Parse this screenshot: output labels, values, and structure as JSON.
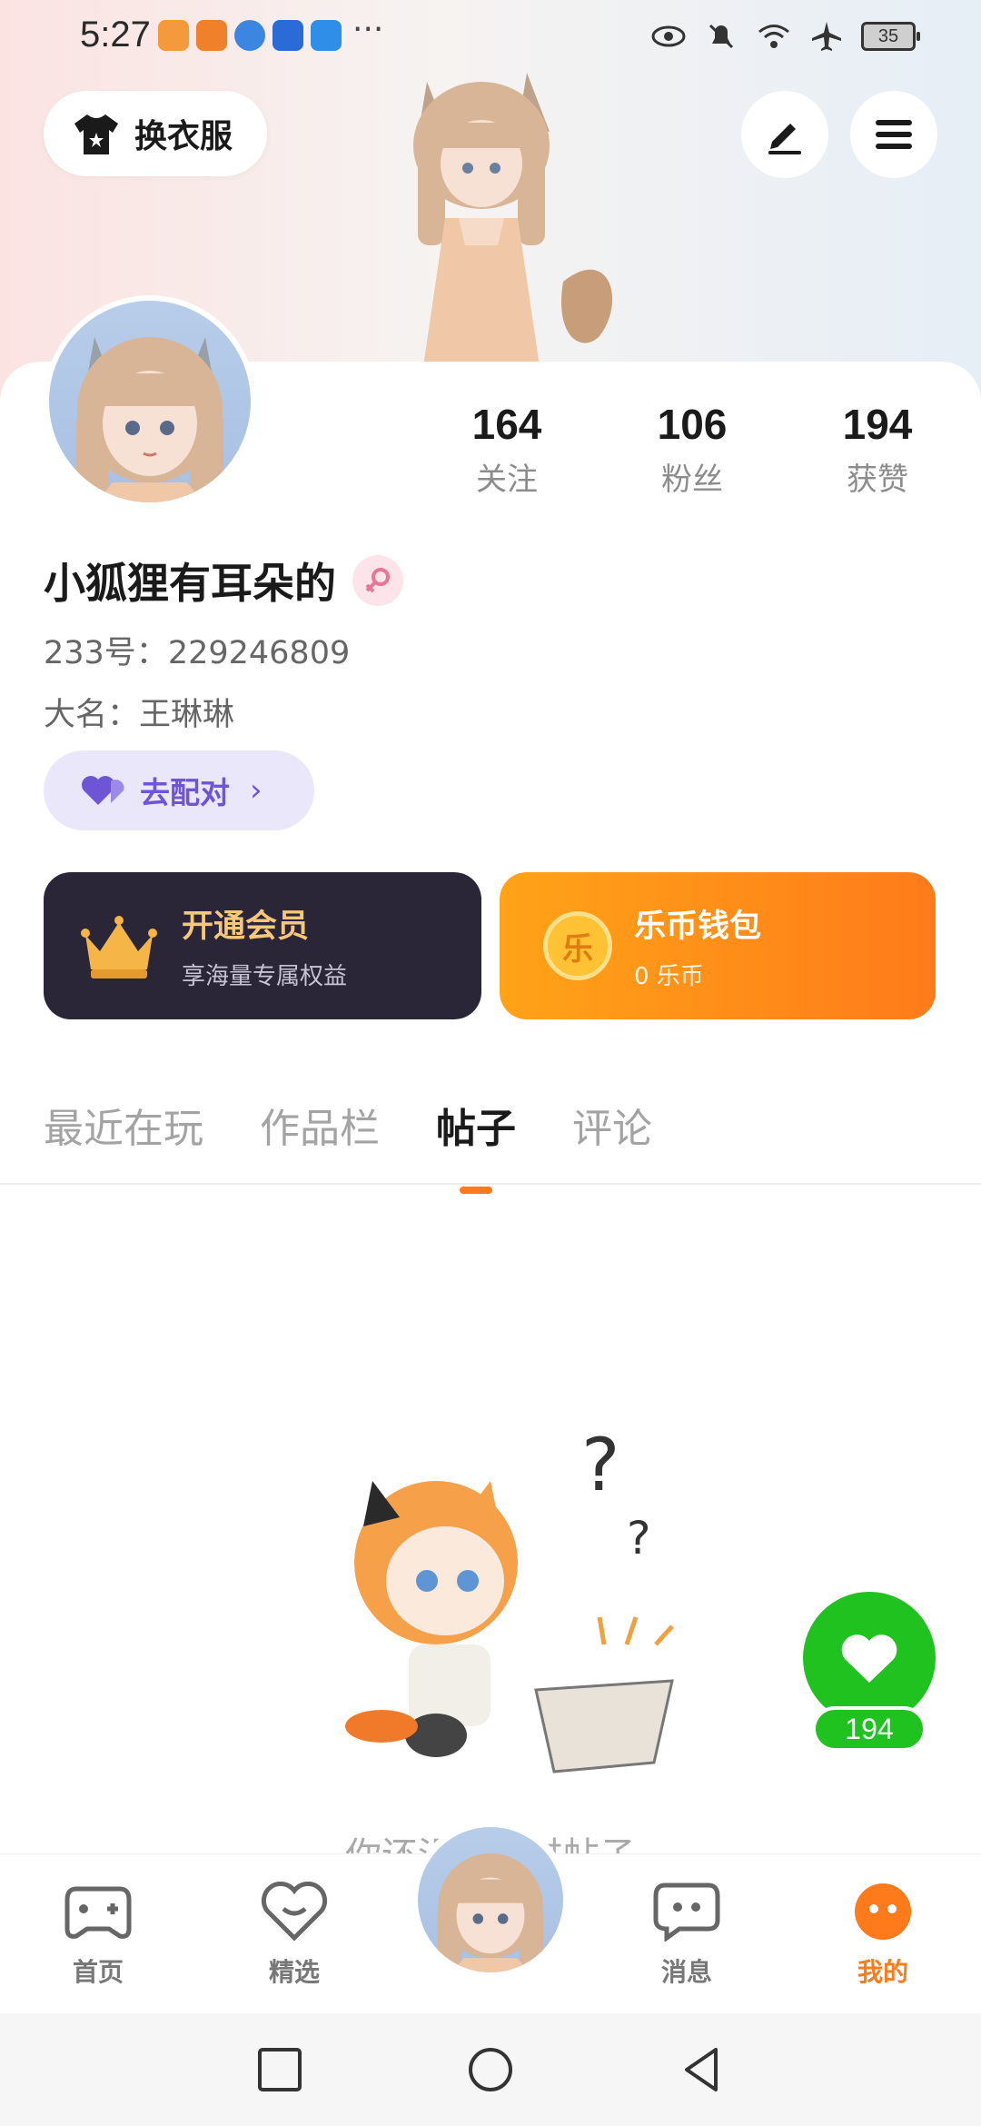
{
  "status_bar": {
    "time": "5:27",
    "more": "···",
    "battery": "35",
    "app_icon_colors": [
      "#f59a3c",
      "#f0802a",
      "#3b86e0",
      "#2a6bd8",
      "#2f8fe8"
    ]
  },
  "header": {
    "outfit_button_label": "换衣服",
    "edit_icon": "edit-icon",
    "menu_icon": "menu-icon"
  },
  "profile": {
    "following_count": "164",
    "following_label": "关注",
    "followers_count": "106",
    "followers_label": "粉丝",
    "likes_count": "194",
    "likes_label": "获赞",
    "name": "小狐狸有耳朵的",
    "gender_icon": "female-icon",
    "id_label": "233号：",
    "id_value": "229246809",
    "real_name_label": "大名：",
    "real_name_value": "王琳琳",
    "pair_button_label": "去配对"
  },
  "promos": {
    "vip_title": "开通会员",
    "vip_subtitle": "享海量专属权益",
    "wallet_title": "乐币钱包",
    "wallet_subtitle": "0 乐币",
    "wallet_coin_char": "乐"
  },
  "tabs": [
    {
      "label": "最近在玩",
      "active": false
    },
    {
      "label": "作品栏",
      "active": false
    },
    {
      "label": "帖子",
      "active": true
    },
    {
      "label": "评论",
      "active": false
    }
  ],
  "empty_state": {
    "text": "你还没有发过帖子"
  },
  "like_fab": {
    "count": "194"
  },
  "bottom_nav": [
    {
      "label": "首页",
      "icon": "gamepad-icon",
      "active": false
    },
    {
      "label": "精选",
      "icon": "heart-chat-icon",
      "active": false
    },
    {
      "label": "消息",
      "icon": "message-icon",
      "active": false
    },
    {
      "label": "我的",
      "icon": "profile-face-icon",
      "active": true
    }
  ],
  "colors": {
    "accent": "#ff7a1a",
    "like_green": "#1fc21f",
    "pair_purple": "#6e55d6",
    "vip_bg": "#2a2637"
  }
}
